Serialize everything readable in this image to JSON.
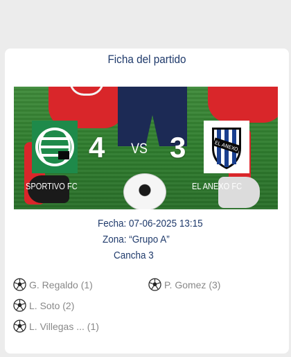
{
  "header": {
    "title": "Ficha del partido"
  },
  "match": {
    "home": {
      "name": "SPORTIVO FC",
      "score": "4"
    },
    "away": {
      "name": "EL ANEXO FC",
      "score": "3"
    },
    "vs_label": "VS",
    "logo_text_right": "EL ANEXO",
    "date": "Fecha: 07-06-2025 13:15",
    "zone": "Zona: “Grupo A”",
    "court": "Cancha 3"
  },
  "scorers": {
    "home": [
      {
        "label": "G. Regaldo (1)"
      },
      {
        "label": "L. Soto (2)"
      },
      {
        "label": "L. Villegas ... (1)"
      }
    ],
    "away": [
      {
        "label": "P. Gomez (3)"
      }
    ]
  },
  "colors": {
    "accent": "#1f3a6b",
    "pitch": "#2f7d2e",
    "home_logo": "#1e8a4a",
    "away_logo": "#1a3f8f"
  },
  "icons": [
    "soccer-ball-icon"
  ]
}
